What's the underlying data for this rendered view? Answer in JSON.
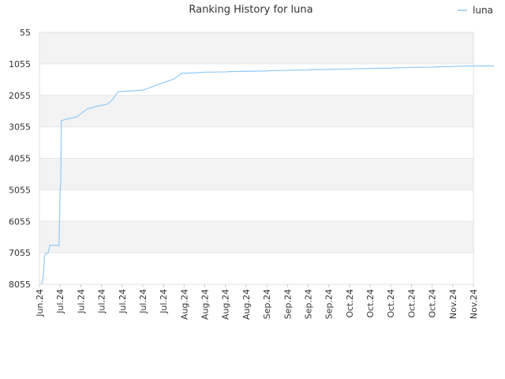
{
  "chart_data": {
    "type": "line",
    "title": "Ranking History for luna",
    "xlabel": "",
    "ylabel": "",
    "y_reversed": true,
    "ylim": [
      55,
      8055
    ],
    "y_ticks": [
      "55",
      "1055",
      "2055",
      "3055",
      "4055",
      "5055",
      "6055",
      "7055",
      "8055"
    ],
    "x_ticks": [
      "Jun.24",
      "Jul.24",
      "Jul.24",
      "Jul.24",
      "Jul.24",
      "Jul.24",
      "Jul.24",
      "Aug.24",
      "Aug.24",
      "Aug.24",
      "Aug.24",
      "Sep.24",
      "Sep.24",
      "Sep.24",
      "Sep.24",
      "Oct.24",
      "Oct.24",
      "Oct.24",
      "Oct.24",
      "Oct.24",
      "Nov.24",
      "Nov.24"
    ],
    "legend": {
      "position": "top-right"
    },
    "grid": true,
    "band_color": "#f3f3f3",
    "series": [
      {
        "name": "luna",
        "color": "#90caf9",
        "points": [
          [
            0.1,
            8055
          ],
          [
            0.15,
            7940
          ],
          [
            0.2,
            7680
          ],
          [
            0.24,
            7180
          ],
          [
            0.3,
            7080
          ],
          [
            0.42,
            7060
          ],
          [
            0.5,
            6820
          ],
          [
            0.6,
            6820
          ],
          [
            0.85,
            6820
          ],
          [
            0.95,
            6820
          ],
          [
            1.0,
            5050
          ],
          [
            1.03,
            4840
          ],
          [
            1.06,
            2860
          ],
          [
            1.3,
            2810
          ],
          [
            1.8,
            2740
          ],
          [
            2.3,
            2490
          ],
          [
            2.8,
            2400
          ],
          [
            3.3,
            2330
          ],
          [
            3.55,
            2180
          ],
          [
            3.8,
            1940
          ],
          [
            4.5,
            1910
          ],
          [
            5.0,
            1890
          ],
          [
            5.5,
            1770
          ],
          [
            6.0,
            1650
          ],
          [
            6.5,
            1540
          ],
          [
            6.75,
            1420
          ],
          [
            6.85,
            1355
          ],
          [
            7.5,
            1340
          ],
          [
            8.0,
            1320
          ],
          [
            9.0,
            1310
          ],
          [
            9.2,
            1300
          ],
          [
            10.0,
            1290
          ],
          [
            11.0,
            1280
          ],
          [
            11.2,
            1270
          ],
          [
            12.0,
            1260
          ],
          [
            13.0,
            1250
          ],
          [
            13.2,
            1240
          ],
          [
            14.0,
            1230
          ],
          [
            15.0,
            1220
          ],
          [
            15.2,
            1210
          ],
          [
            16.0,
            1200
          ],
          [
            17.0,
            1190
          ],
          [
            17.2,
            1180
          ],
          [
            18.0,
            1170
          ],
          [
            19.0,
            1160
          ],
          [
            19.2,
            1150
          ],
          [
            20.0,
            1140
          ],
          [
            20.2,
            1130
          ],
          [
            21.0,
            1120
          ],
          [
            22.0,
            1120
          ]
        ]
      }
    ]
  }
}
